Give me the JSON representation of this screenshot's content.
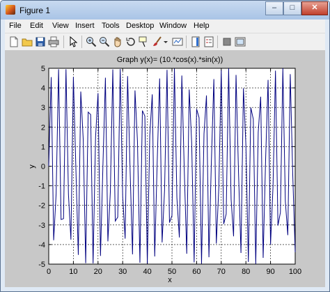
{
  "window": {
    "title": "Figure 1",
    "minimize_symbol": "–",
    "maximize_symbol": "□",
    "close_symbol": "✕"
  },
  "menu": [
    "File",
    "Edit",
    "View",
    "Insert",
    "Tools",
    "Desktop",
    "Window",
    "Help"
  ],
  "toolbar": [
    "new-figure-icon",
    "open-file-icon",
    "save-icon",
    "print-icon",
    "edit-plot-arrow-icon",
    "zoom-in-icon",
    "zoom-out-icon",
    "pan-hand-icon",
    "rotate-3d-icon",
    "data-cursor-icon",
    "brush-icon",
    "brush-dropdown-icon",
    "link-plot-icon",
    "insert-colorbar-icon",
    "insert-legend-icon",
    "hide-plot-tools-icon",
    "show-plot-tools-icon"
  ],
  "chart_data": {
    "type": "line",
    "title": "Graph y(x)= (10.*cos(x).*sin(x))",
    "xlabel": "x",
    "ylabel": "y",
    "xlim": [
      0,
      100
    ],
    "ylim": [
      -5,
      5
    ],
    "xticks": [
      0,
      10,
      20,
      30,
      40,
      50,
      60,
      70,
      80,
      90,
      100
    ],
    "yticks": [
      -5,
      -4,
      -3,
      -2,
      -1,
      0,
      1,
      2,
      3,
      4,
      5
    ],
    "xtick_labels": [
      "0",
      "10",
      "20",
      "30",
      "40",
      "50",
      "60",
      "70",
      "80",
      "90",
      "100"
    ],
    "ytick_labels": [
      "-5",
      "-4",
      "-3",
      "-2",
      "-1",
      "0",
      "1",
      "2",
      "3",
      "4",
      "5"
    ],
    "grid": true,
    "line_color": "#00007f",
    "series": [
      {
        "x": [
          0,
          1,
          2,
          3,
          4,
          5,
          6,
          7,
          8,
          9,
          10,
          11,
          12,
          13,
          14,
          15,
          16,
          17,
          18,
          19,
          20,
          21,
          22,
          23,
          24,
          25,
          26,
          27,
          28,
          29,
          30,
          31,
          32,
          33,
          34,
          35,
          36,
          37,
          38,
          39,
          40,
          41,
          42,
          43,
          44,
          45,
          46,
          47,
          48,
          49,
          50,
          51,
          52,
          53,
          54,
          55,
          56,
          57,
          58,
          59,
          60,
          61,
          62,
          63,
          64,
          65,
          66,
          67,
          68,
          69,
          70,
          71,
          72,
          73,
          74,
          75,
          76,
          77,
          78,
          79,
          80,
          81,
          82,
          83,
          84,
          85,
          86,
          87,
          88,
          89,
          90,
          91,
          92,
          93,
          94,
          95,
          96,
          97,
          98,
          99,
          100
        ],
        "y": [
          0,
          4.55,
          -3.78,
          -1.4,
          4.95,
          -2.72,
          -2.68,
          4.95,
          -1.44,
          -3.75,
          4.56,
          -0.04,
          -4.53,
          3.81,
          1.35,
          -4.95,
          2.76,
          2.64,
          -4.96,
          1.48,
          3.73,
          -4.58,
          0.09,
          4.52,
          -3.84,
          -1.31,
          4.94,
          -2.8,
          -2.6,
          4.96,
          -1.53,
          -3.7,
          4.6,
          -0.13,
          -4.5,
          3.87,
          1.27,
          -4.93,
          2.84,
          2.56,
          -4.97,
          1.57,
          3.67,
          -4.61,
          0.18,
          4.48,
          -3.89,
          -1.22,
          4.92,
          -2.88,
          -2.52,
          4.98,
          -1.61,
          -3.64,
          4.63,
          -0.22,
          -4.47,
          3.92,
          1.18,
          -4.91,
          2.92,
          2.48,
          -4.98,
          1.66,
          3.61,
          -4.65,
          0.27,
          4.45,
          -3.95,
          -1.13,
          4.9,
          -2.95,
          -2.44,
          4.99,
          -1.7,
          -3.58,
          4.66,
          -0.31,
          -4.43,
          3.98,
          1.09,
          -4.89,
          2.99,
          2.4,
          -4.99,
          1.74,
          3.55,
          -4.68,
          0.35,
          4.41,
          -4.0,
          -1.05,
          4.88,
          -3.03,
          -2.36,
          5.0,
          -1.78,
          -3.52,
          4.7,
          -0.4,
          -4.39
        ]
      }
    ]
  }
}
